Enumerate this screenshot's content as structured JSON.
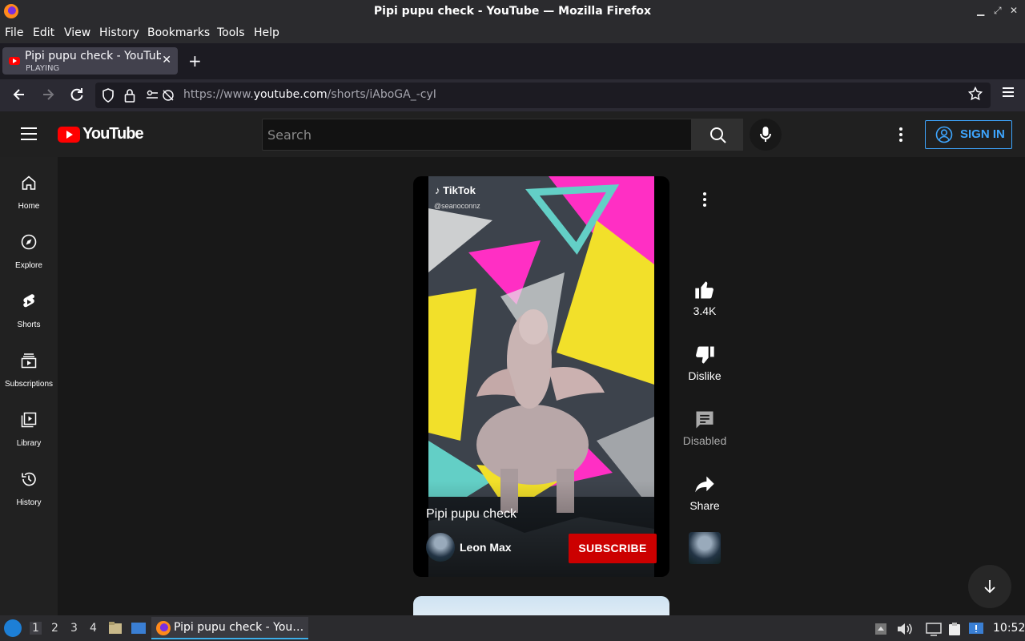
{
  "window": {
    "title": "Pipi pupu check - YouTube — Mozilla Firefox"
  },
  "menu": [
    "File",
    "Edit",
    "View",
    "History",
    "Bookmarks",
    "Tools",
    "Help"
  ],
  "tab": {
    "title": "Pipi pupu check - YouTube",
    "status": "PLAYING"
  },
  "address": {
    "prefix": "https://www.",
    "domain": "youtube.com",
    "path": "/shorts/iAboGA_-cyI"
  },
  "youtube": {
    "wordmark": "YouTube",
    "search_placeholder": "Search",
    "sign_in": "SIGN IN",
    "sidebar": [
      {
        "label": "Home",
        "icon": "home-icon"
      },
      {
        "label": "Explore",
        "icon": "compass-icon"
      },
      {
        "label": "Shorts",
        "icon": "shorts-icon"
      },
      {
        "label": "Subscriptions",
        "icon": "subscriptions-icon"
      },
      {
        "label": "Library",
        "icon": "library-icon"
      },
      {
        "label": "History",
        "icon": "history-icon"
      }
    ],
    "short": {
      "watermark": "TikTok",
      "watermark_user": "@seanoconnz",
      "title": "Pipi pupu check",
      "channel": "Leon Max",
      "subscribe": "SUBSCRIBE"
    },
    "actions": {
      "like_count": "3.4K",
      "dislike": "Dislike",
      "comments": "Disabled",
      "share": "Share"
    }
  },
  "taskbar": {
    "workspaces": [
      "1",
      "2",
      "3",
      "4"
    ],
    "task_title": "Pipi pupu check - You…",
    "clock": "10:52"
  },
  "colors": {
    "accent_blue": "#3ea6ff",
    "subscribe_red": "#cc0000",
    "yt_red": "#ff0000"
  }
}
